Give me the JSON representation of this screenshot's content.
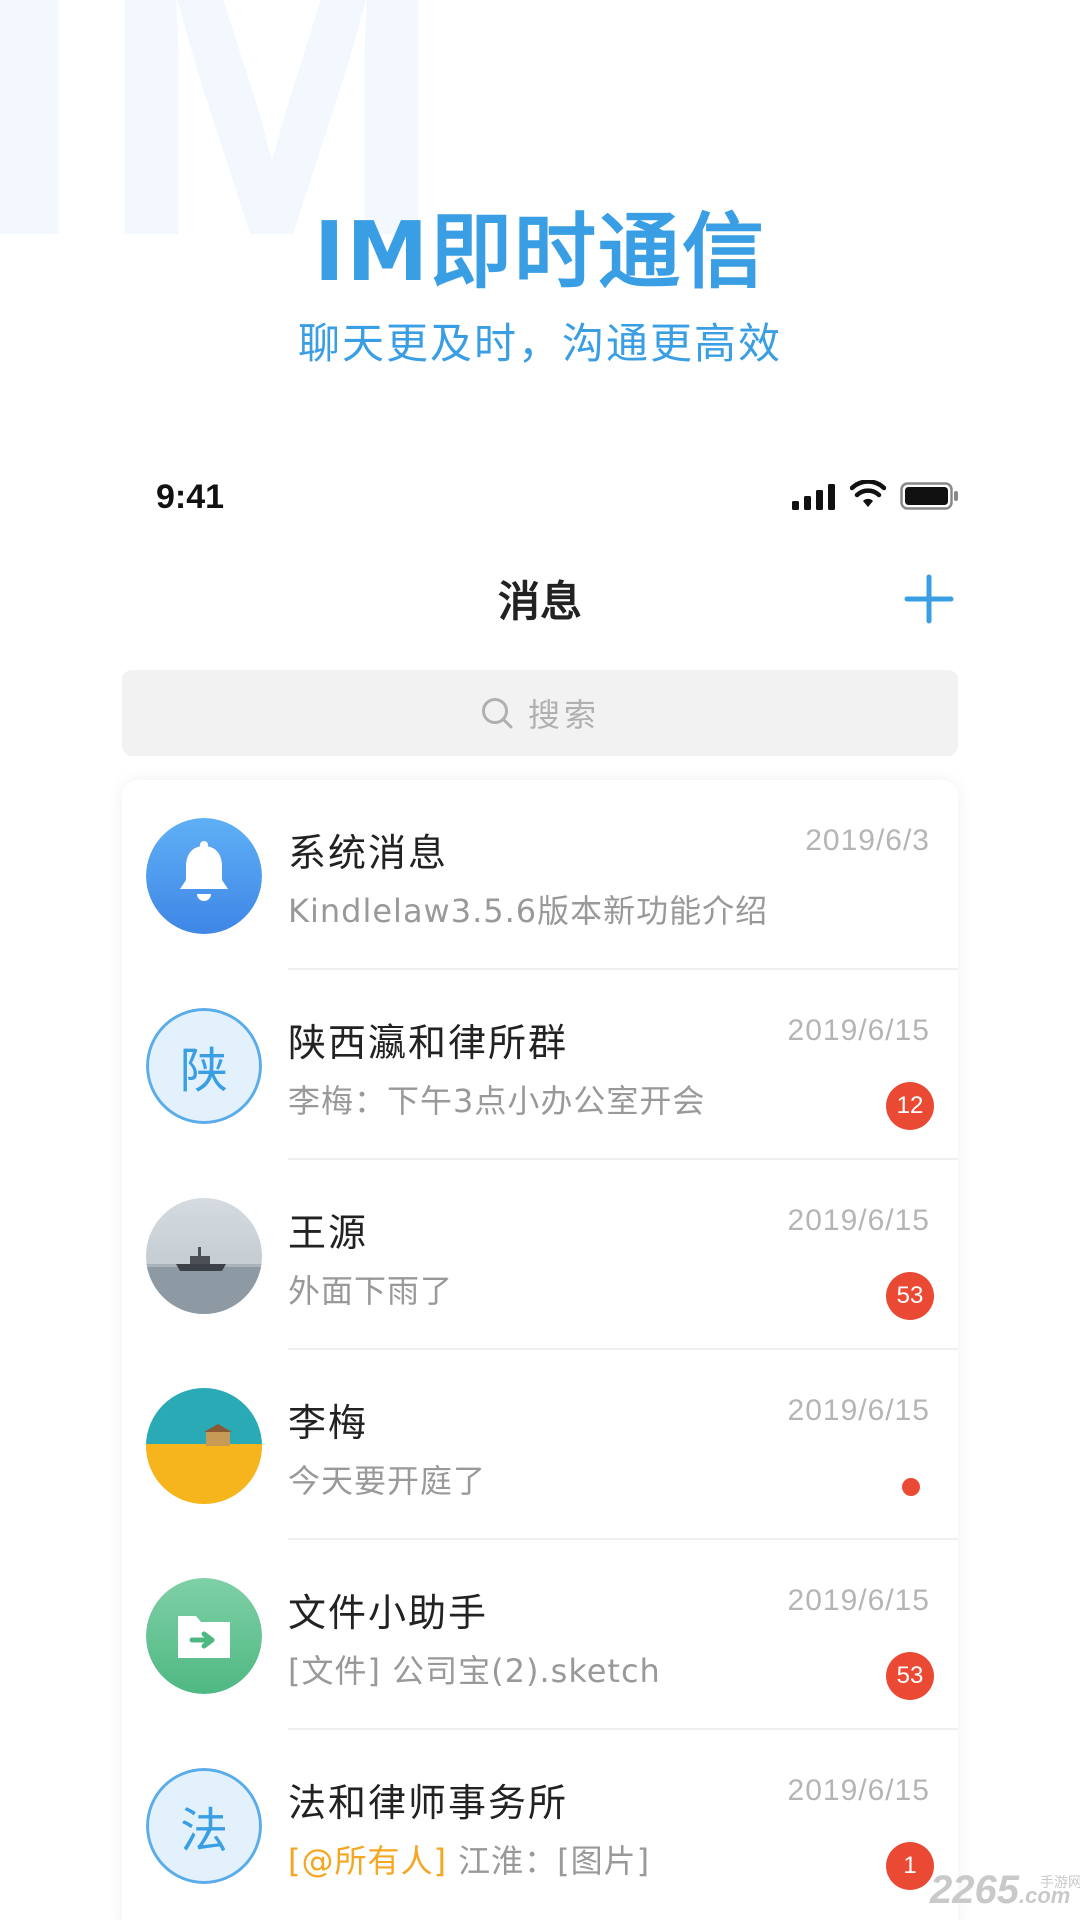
{
  "promo": {
    "watermark": "IM",
    "title": "IM即时通信",
    "subtitle": "聊天更及时，沟通更高效"
  },
  "status_bar": {
    "time": "9:41",
    "icons": [
      "signal-icon",
      "wifi-icon",
      "battery-icon"
    ]
  },
  "nav": {
    "title": "消息",
    "add_icon": "plus-icon"
  },
  "search": {
    "icon": "search-icon",
    "placeholder": "搜索"
  },
  "conversations": [
    {
      "name": "系统消息",
      "time": "2019/6/3",
      "preview": "Kindlelaw3.5.6版本新功能介绍",
      "avatar": "bell-icon"
    },
    {
      "name": "陕西瀛和律所群",
      "time": "2019/6/15",
      "preview": "李梅：下午3点小办公室开会",
      "avatar_letter": "陕",
      "badge": "12"
    },
    {
      "name": "王源",
      "time": "2019/6/15",
      "preview": "外面下雨了",
      "avatar": "boat-photo",
      "badge": "53"
    },
    {
      "name": "李梅",
      "time": "2019/6/15",
      "preview": "今天要开庭了",
      "avatar": "beach-photo",
      "badge_dot": true
    },
    {
      "name": "文件小助手",
      "time": "2019/6/15",
      "preview": "[文件] 公司宝(2).sketch",
      "avatar": "folder-icon",
      "badge": "53"
    },
    {
      "name": "法和律师事务所",
      "time": "2019/6/15",
      "mention": "[@所有人]",
      "preview": " 江淮：[图片]",
      "avatar_letter": "法",
      "badge": "1"
    }
  ],
  "footer": {
    "logo": "2265",
    "logo_suffix": ".com",
    "logo_caption": "手游网"
  },
  "colors": {
    "accent": "#3a9ee4",
    "badge": "#ea4a34",
    "mention": "#f5a623"
  }
}
